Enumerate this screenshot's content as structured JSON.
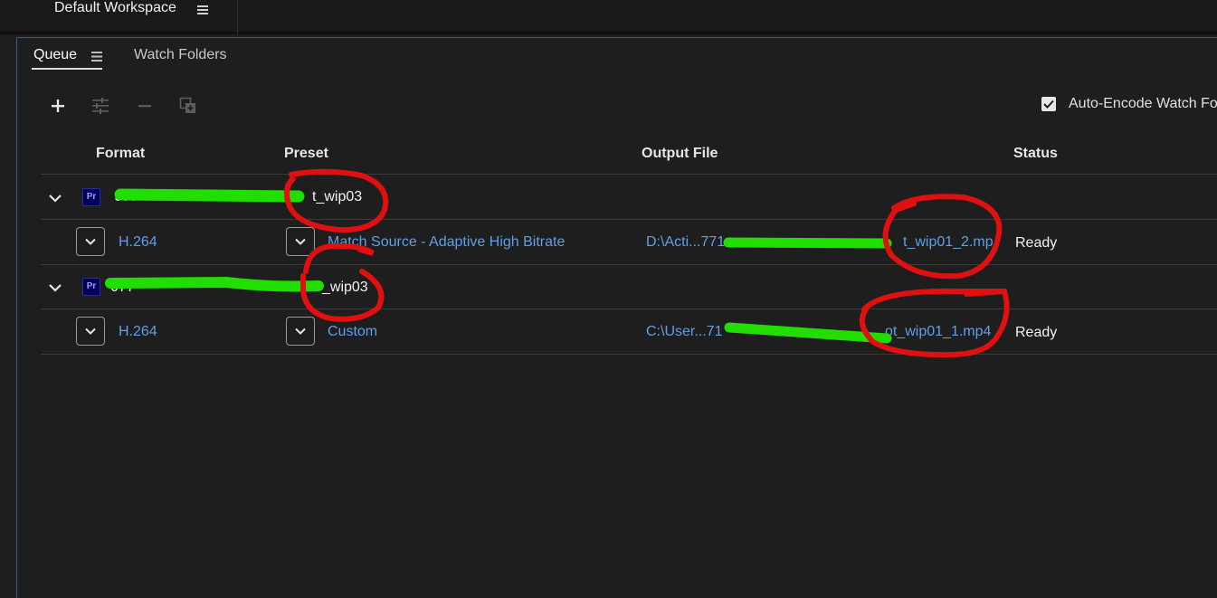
{
  "workspace": {
    "title": "Default Workspace",
    "menu_icon": "hamburger-icon"
  },
  "tabs": [
    {
      "label": "Queue",
      "active": true
    },
    {
      "label": "Watch Folders",
      "active": false
    }
  ],
  "toolbar": {
    "add_icon": "plus-icon",
    "settings_icon": "sliders-icon",
    "remove_icon": "minus-icon",
    "duplicate_icon": "duplicate-icon"
  },
  "auto_encode": {
    "label": "Auto-Encode Watch Fo",
    "checked": true
  },
  "columns": [
    "Format",
    "Preset",
    "Output File",
    "Status"
  ],
  "queue": [
    {
      "source_name": "t_wip03",
      "source_prefix": "J77",
      "app_badge": "Pr",
      "items": [
        {
          "format": "H.264",
          "preset": "Match Source - Adaptive High Bitrate",
          "output_prefix": "D:\\Acti...771",
          "output_suffix": "t_wip01_2.mp",
          "status": "Ready"
        }
      ]
    },
    {
      "source_name": "_wip03",
      "source_prefix": "J77",
      "app_badge": "Pr",
      "items": [
        {
          "format": "H.264",
          "preset": "Custom",
          "output_prefix": "C:\\User...71",
          "output_suffix": "ot_wip01_1.mp4",
          "status": "Ready"
        }
      ]
    }
  ],
  "colors": {
    "background": "#1e1e1e",
    "link": "#5f9fe6",
    "redaction": "#22dd00",
    "annotation": "#e01010",
    "badge_bg": "#00005b",
    "badge_text": "#9999ff"
  }
}
